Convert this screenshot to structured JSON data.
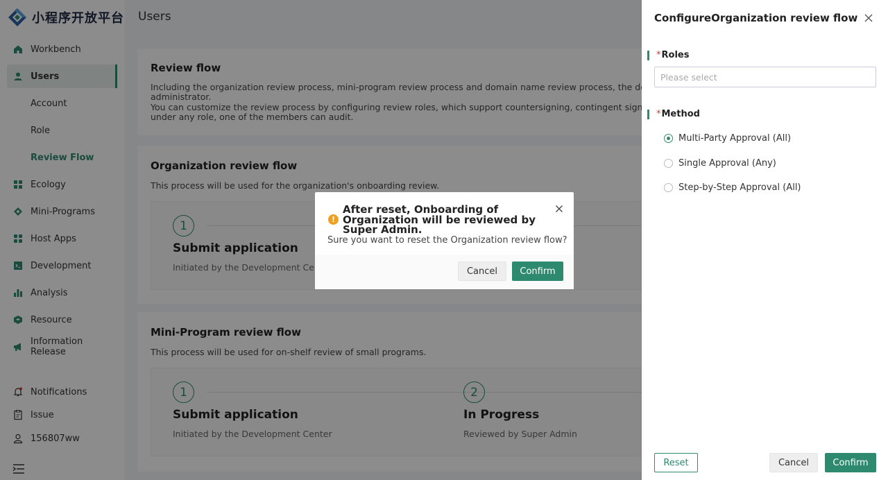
{
  "sidebar": {
    "logo_text": "小程序开放平台",
    "items": [
      {
        "label": "Workbench",
        "icon": "home-icon"
      },
      {
        "label": "Users",
        "icon": "user-icon"
      },
      {
        "label": "Account"
      },
      {
        "label": "Role"
      },
      {
        "label": "Review Flow"
      },
      {
        "label": "Ecology",
        "icon": "grid-icon"
      },
      {
        "label": "Mini-Programs",
        "icon": "diamond-icon"
      },
      {
        "label": "Host Apps",
        "icon": "apps-icon"
      },
      {
        "label": "Development",
        "icon": "code-icon"
      },
      {
        "label": "Analysis",
        "icon": "chart-icon"
      },
      {
        "label": "Resource",
        "icon": "cube-icon"
      },
      {
        "label": "Information Release",
        "icon": "megaphone-icon"
      }
    ],
    "bottom": {
      "notifications": "Notifications",
      "issue": "Issue",
      "user": "156807ww"
    }
  },
  "main": {
    "title": "Users",
    "review": {
      "title": "Review flow",
      "line1": "Including the organization review process, mini-program review process and domain name review process, the default are",
      "line2": "administrator.",
      "line3": "You can customize the review process by configuring review roles, which support countersigning, contingent signing and s",
      "line4": "under any role, one of the members can audit."
    },
    "org": {
      "title": "Organization review flow",
      "desc": "This process will be used for the organization's onboarding review.",
      "steps": [
        {
          "num": "1",
          "title": "Submit application",
          "desc": "Initiated by the Development Center"
        }
      ]
    },
    "mini": {
      "title": "Mini-Program review flow",
      "desc": "This process will be used for on-shelf review of small programs.",
      "steps": [
        {
          "num": "1",
          "title": "Submit application",
          "desc": "Initiated by the Development Center"
        },
        {
          "num": "2",
          "title": "In Progress",
          "desc": "Reviewed by Super Admin"
        }
      ]
    }
  },
  "drawer": {
    "title": "ConfigureOrganization review flow",
    "roles_label": "Roles",
    "roles_placeholder": "Please select",
    "method_label": "Method",
    "required_mark": "*",
    "methods": [
      {
        "label": "Multi-Party Approval (All)",
        "checked": true
      },
      {
        "label": "Single Approval (Any)",
        "checked": false
      },
      {
        "label": "Step-by-Step Approval (All)",
        "checked": false
      }
    ],
    "reset": "Reset",
    "cancel": "Cancel",
    "confirm": "Confirm"
  },
  "modal": {
    "title": "After reset, Onboarding of Organization will be reviewed by Super Admin.",
    "warn_glyph": "!",
    "body": "Sure you want to reset the Organization review flow?",
    "cancel": "Cancel",
    "confirm": "Confirm"
  },
  "colors": {
    "accent": "#2e8a6e",
    "warning": "#f0a020",
    "required": "#dd3333"
  }
}
